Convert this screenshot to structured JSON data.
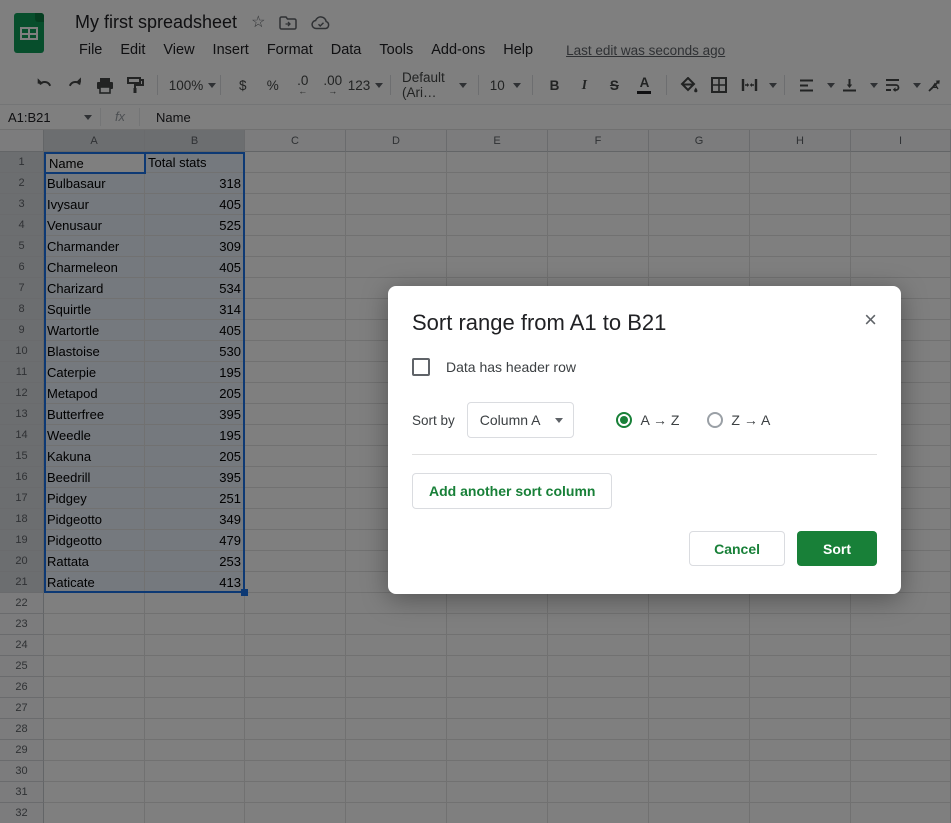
{
  "header": {
    "title": "My first spreadsheet",
    "menu": [
      "File",
      "Edit",
      "View",
      "Insert",
      "Format",
      "Data",
      "Tools",
      "Add-ons",
      "Help"
    ],
    "last_edit": "Last edit was seconds ago",
    "icons": [
      "star-icon",
      "move-to-folder-icon",
      "cloud-saved-icon"
    ]
  },
  "toolbar": {
    "zoom": "100%",
    "currency": "$",
    "percent": "%",
    "decrease_decimal": ".0",
    "increase_decimal": ".00",
    "more_formats": "123",
    "font": "Default (Ari…",
    "font_size": "10",
    "bold": "B",
    "italic": "I",
    "strikethrough": "S",
    "text_color": "A",
    "icons": [
      "undo-icon",
      "redo-icon",
      "print-icon",
      "paint-format-icon",
      "fill-color-icon",
      "borders-icon",
      "merge-cells-icon",
      "horizontal-align-icon",
      "vertical-align-icon",
      "text-wrap-icon",
      "text-rotation-icon"
    ]
  },
  "formula_bar": {
    "name_box": "A1:B21",
    "fx_label": "fx",
    "content": "Name"
  },
  "sheet": {
    "columns": [
      "A",
      "B",
      "C",
      "D",
      "E",
      "F",
      "G",
      "H",
      "I"
    ],
    "row_count": 32,
    "selection": {
      "range": "A1:B21",
      "active_cell": "A1"
    },
    "data": {
      "headers": [
        "Name",
        "Total stats"
      ],
      "rows": [
        [
          "Bulbasaur",
          "318"
        ],
        [
          "Ivysaur",
          "405"
        ],
        [
          "Venusaur",
          "525"
        ],
        [
          "Charmander",
          "309"
        ],
        [
          "Charmeleon",
          "405"
        ],
        [
          "Charizard",
          "534"
        ],
        [
          "Squirtle",
          "314"
        ],
        [
          "Wartortle",
          "405"
        ],
        [
          "Blastoise",
          "530"
        ],
        [
          "Caterpie",
          "195"
        ],
        [
          "Metapod",
          "205"
        ],
        [
          "Butterfree",
          "395"
        ],
        [
          "Weedle",
          "195"
        ],
        [
          "Kakuna",
          "205"
        ],
        [
          "Beedrill",
          "395"
        ],
        [
          "Pidgey",
          "251"
        ],
        [
          "Pidgeotto",
          "349"
        ],
        [
          "Pidgeotto",
          "479"
        ],
        [
          "Rattata",
          "253"
        ],
        [
          "Raticate",
          "413"
        ]
      ]
    }
  },
  "dialog": {
    "title": "Sort range from A1 to B21",
    "header_checkbox_label": "Data has header row",
    "checkbox_checked": false,
    "sort_by_label": "Sort by",
    "column_value": "Column A",
    "radio_az": "A → Z",
    "radio_za": "Z → A",
    "selected_radio": "A → Z",
    "add_column_label": "Add another sort column",
    "cancel_label": "Cancel",
    "sort_label": "Sort"
  },
  "colors": {
    "accent_green": "#188038",
    "logo_green": "#0f9d58",
    "selection_blue": "#1a73e8"
  }
}
